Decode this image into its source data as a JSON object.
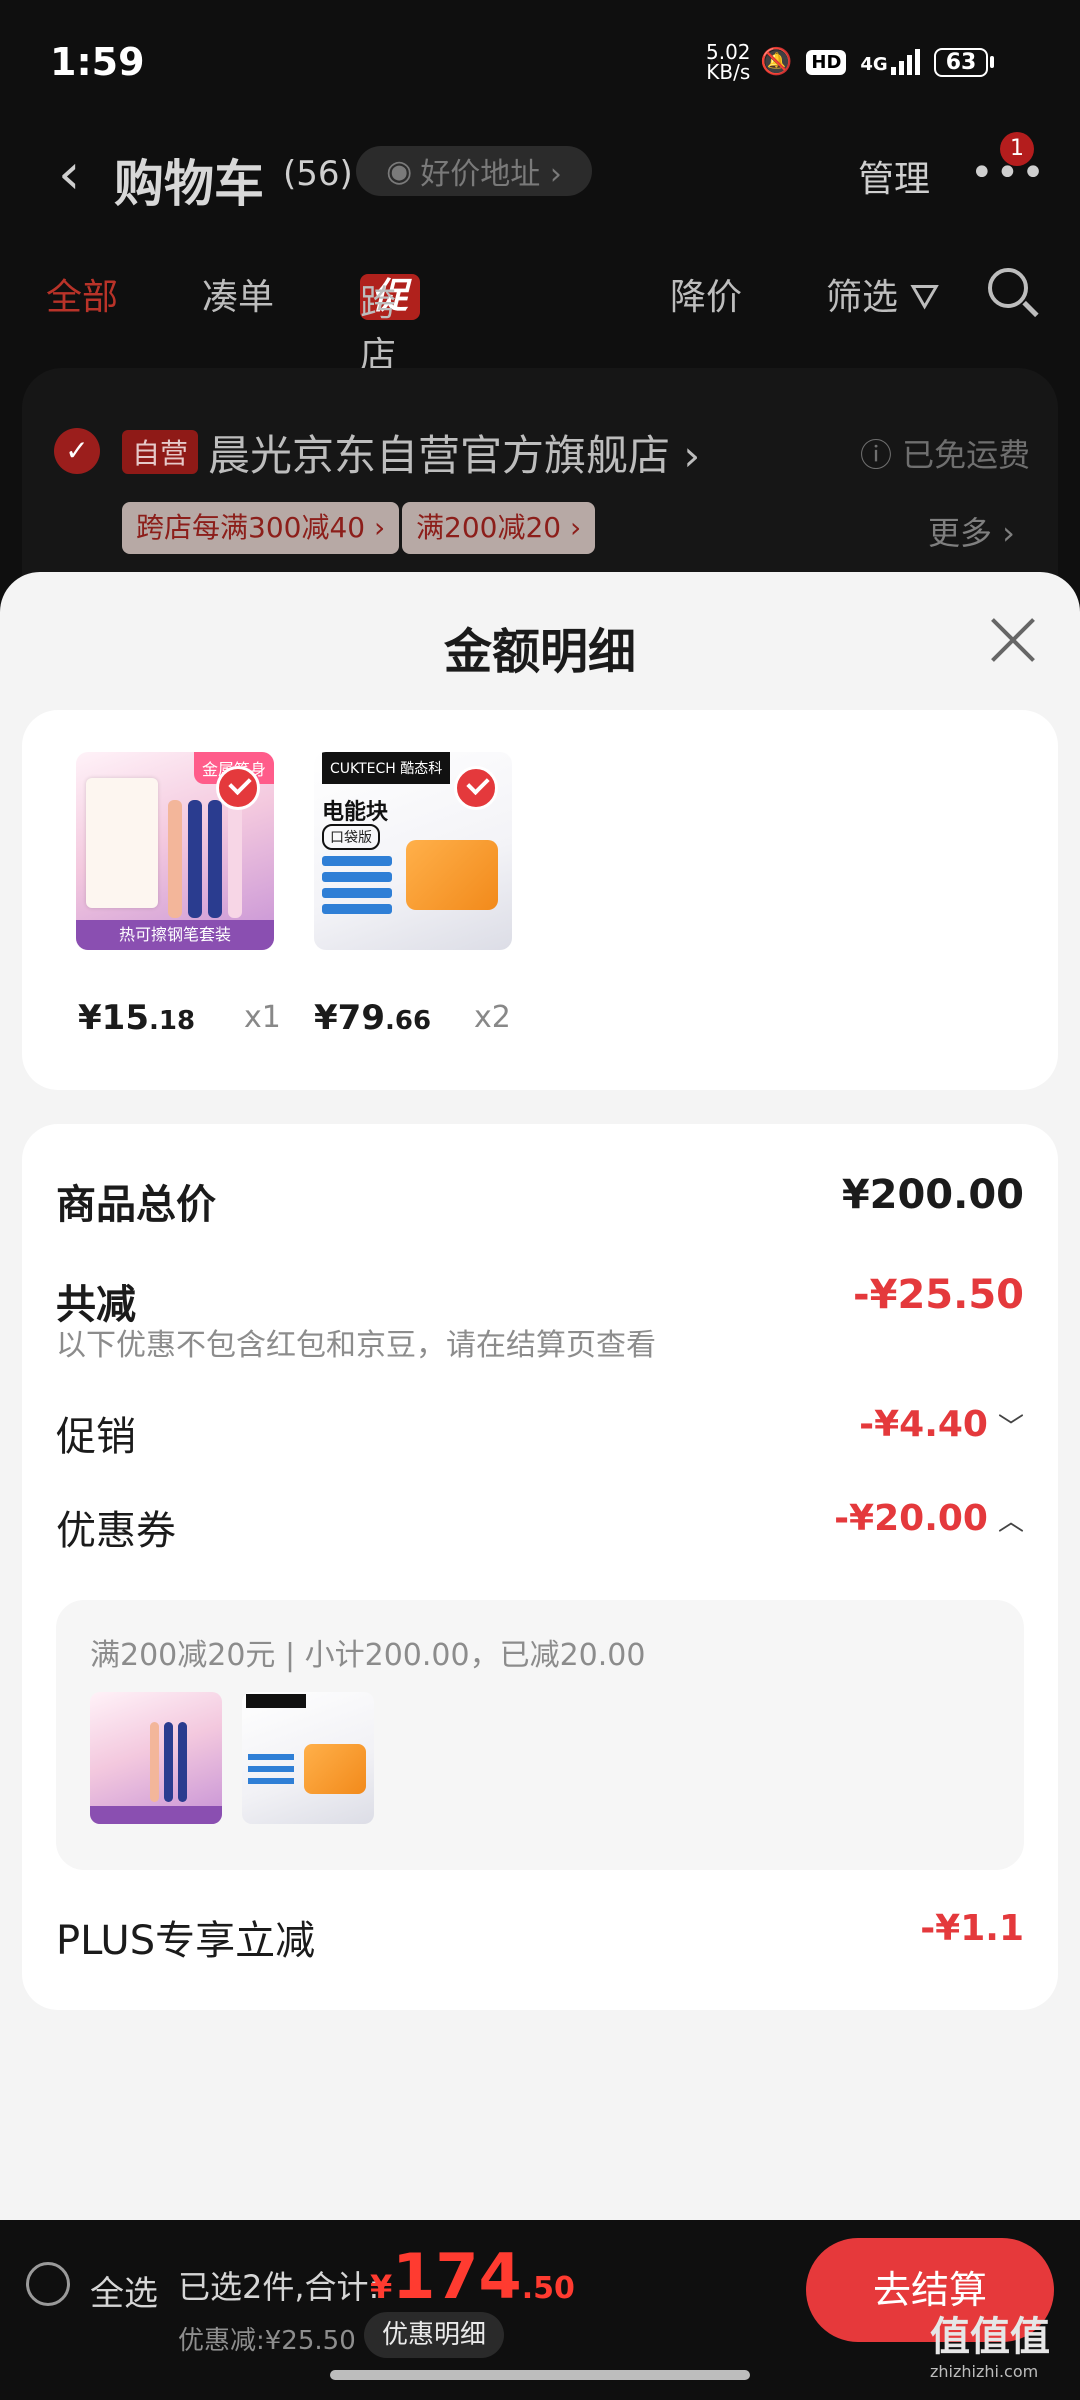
{
  "status": {
    "time": "1:59",
    "netspeed_value": "5.02",
    "netspeed_unit": "KB/s",
    "hd": "HD",
    "network": "4G",
    "battery": "63"
  },
  "nav": {
    "back": "‹",
    "title": "购物车",
    "count": "(56)",
    "address_pill": "好价地址 ›",
    "manage": "管理",
    "more": "•••",
    "badge": "1"
  },
  "filters": {
    "all": "全部",
    "bundle": "凑单",
    "promo_tag": "促",
    "cross_store": "跨店满减",
    "price_drop": "降价",
    "filter": "筛选 ⛛"
  },
  "store": {
    "self_tag": "自营",
    "name": "晨光京东自营官方旗舰店 ›",
    "free_shipping": "ⓘ 已免运费",
    "coupon1": "跨店每满300减40 ›",
    "coupon2": "满200减20 ›",
    "more": "更多 ›"
  },
  "sheet": {
    "title": "金额明细",
    "items": [
      {
        "price_main": "¥15",
        "price_dec": ".18",
        "qty": "x1",
        "corner": "金属笔身",
        "strip": "热可擦钢笔套装"
      },
      {
        "price_main": "¥79",
        "price_dec": ".66",
        "qty": "x2",
        "brand": "CUKTECH 酷态科",
        "name": "电能块",
        "edition": "口袋版"
      }
    ],
    "total_label": "商品总价",
    "total_value": "¥200.00",
    "discount_label": "共减",
    "discount_value": "-¥25.50",
    "note": "以下优惠不包含红包和京豆，请在结算页查看",
    "promo_label": "促销",
    "promo_value": "-¥4.40",
    "promo_caret": "﹀",
    "coupon_label": "优惠券",
    "coupon_value": "-¥20.00",
    "coupon_caret": "︿",
    "coupon_detail": "满200减20元 | 小计200.00，已减20.00",
    "plus_label": "PLUS专享立减",
    "plus_value": "-¥1.1"
  },
  "bottom": {
    "select_all": "全选",
    "summary": "已选2件,合计:",
    "currency": "¥",
    "total_int": "174",
    "total_dec": ".50",
    "saved": "优惠减:¥25.50",
    "detail_button": "优惠明细",
    "checkout": "去结算"
  },
  "watermark": {
    "text": "值值值",
    "sub": "zhizhizhi.com"
  },
  "colors": {
    "accent": "#e4393c",
    "overlay_bg": "#0f0f0f",
    "sheet_bg": "#f4f4f4"
  }
}
